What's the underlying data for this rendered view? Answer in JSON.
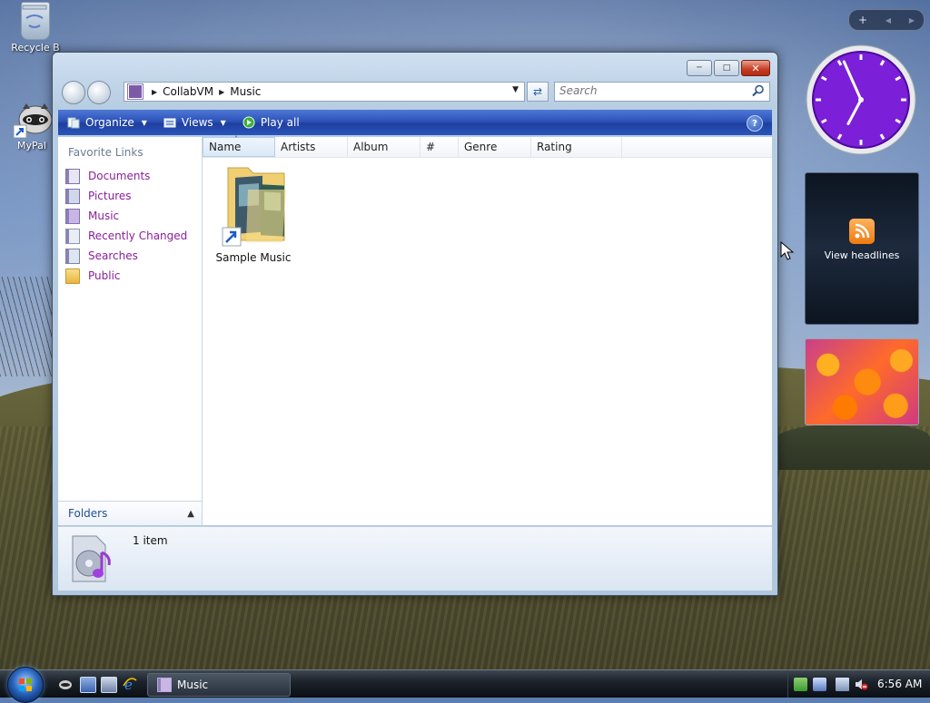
{
  "desktop": {
    "icons": [
      {
        "label": "Recycle B"
      },
      {
        "label": "MyPal"
      }
    ]
  },
  "sidebar": {
    "add_button": "+",
    "feed_gadget_label": "View headlines",
    "clock": {
      "hour": 6,
      "minute": 56
    }
  },
  "window": {
    "breadcrumb": [
      "CollabVM",
      "Music"
    ],
    "search_placeholder": "Search",
    "toolbar": {
      "organize": "Organize",
      "views": "Views",
      "play_all": "Play all",
      "help": "?"
    },
    "nav_pane": {
      "heading": "Favorite Links",
      "links": [
        {
          "label": "Documents",
          "icon": "documents-icon"
        },
        {
          "label": "Pictures",
          "icon": "pictures-icon"
        },
        {
          "label": "Music",
          "icon": "music-icon"
        },
        {
          "label": "Recently Changed",
          "icon": "recently-changed-icon"
        },
        {
          "label": "Searches",
          "icon": "searches-icon"
        },
        {
          "label": "Public",
          "icon": "public-folder-icon"
        }
      ],
      "folders_label": "Folders"
    },
    "columns": [
      "Name",
      "Artists",
      "Album",
      "#",
      "Genre",
      "Rating"
    ],
    "items": [
      {
        "label": "Sample Music"
      }
    ],
    "status": "1 item"
  },
  "taskbar": {
    "task_label": "Music",
    "clock": "6:56 AM"
  },
  "colors": {
    "link_purple": "#8a1f9b",
    "toolbar_blue": "#2d52b8",
    "clock_face": "#7b1fd8"
  }
}
